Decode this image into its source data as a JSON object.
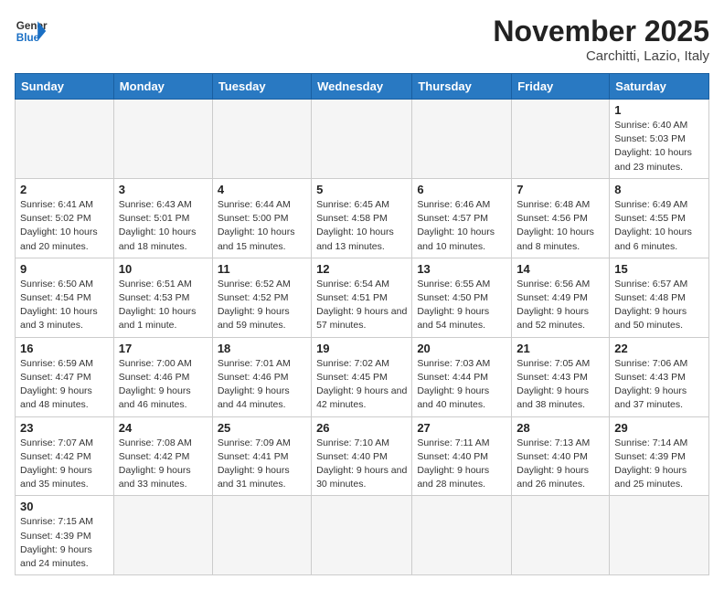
{
  "header": {
    "logo_general": "General",
    "logo_blue": "Blue",
    "month": "November 2025",
    "location": "Carchitti, Lazio, Italy"
  },
  "weekdays": [
    "Sunday",
    "Monday",
    "Tuesday",
    "Wednesday",
    "Thursday",
    "Friday",
    "Saturday"
  ],
  "weeks": [
    [
      {
        "day": "",
        "info": ""
      },
      {
        "day": "",
        "info": ""
      },
      {
        "day": "",
        "info": ""
      },
      {
        "day": "",
        "info": ""
      },
      {
        "day": "",
        "info": ""
      },
      {
        "day": "",
        "info": ""
      },
      {
        "day": "1",
        "info": "Sunrise: 6:40 AM\nSunset: 5:03 PM\nDaylight: 10 hours and 23 minutes."
      }
    ],
    [
      {
        "day": "2",
        "info": "Sunrise: 6:41 AM\nSunset: 5:02 PM\nDaylight: 10 hours and 20 minutes."
      },
      {
        "day": "3",
        "info": "Sunrise: 6:43 AM\nSunset: 5:01 PM\nDaylight: 10 hours and 18 minutes."
      },
      {
        "day": "4",
        "info": "Sunrise: 6:44 AM\nSunset: 5:00 PM\nDaylight: 10 hours and 15 minutes."
      },
      {
        "day": "5",
        "info": "Sunrise: 6:45 AM\nSunset: 4:58 PM\nDaylight: 10 hours and 13 minutes."
      },
      {
        "day": "6",
        "info": "Sunrise: 6:46 AM\nSunset: 4:57 PM\nDaylight: 10 hours and 10 minutes."
      },
      {
        "day": "7",
        "info": "Sunrise: 6:48 AM\nSunset: 4:56 PM\nDaylight: 10 hours and 8 minutes."
      },
      {
        "day": "8",
        "info": "Sunrise: 6:49 AM\nSunset: 4:55 PM\nDaylight: 10 hours and 6 minutes."
      }
    ],
    [
      {
        "day": "9",
        "info": "Sunrise: 6:50 AM\nSunset: 4:54 PM\nDaylight: 10 hours and 3 minutes."
      },
      {
        "day": "10",
        "info": "Sunrise: 6:51 AM\nSunset: 4:53 PM\nDaylight: 10 hours and 1 minute."
      },
      {
        "day": "11",
        "info": "Sunrise: 6:52 AM\nSunset: 4:52 PM\nDaylight: 9 hours and 59 minutes."
      },
      {
        "day": "12",
        "info": "Sunrise: 6:54 AM\nSunset: 4:51 PM\nDaylight: 9 hours and 57 minutes."
      },
      {
        "day": "13",
        "info": "Sunrise: 6:55 AM\nSunset: 4:50 PM\nDaylight: 9 hours and 54 minutes."
      },
      {
        "day": "14",
        "info": "Sunrise: 6:56 AM\nSunset: 4:49 PM\nDaylight: 9 hours and 52 minutes."
      },
      {
        "day": "15",
        "info": "Sunrise: 6:57 AM\nSunset: 4:48 PM\nDaylight: 9 hours and 50 minutes."
      }
    ],
    [
      {
        "day": "16",
        "info": "Sunrise: 6:59 AM\nSunset: 4:47 PM\nDaylight: 9 hours and 48 minutes."
      },
      {
        "day": "17",
        "info": "Sunrise: 7:00 AM\nSunset: 4:46 PM\nDaylight: 9 hours and 46 minutes."
      },
      {
        "day": "18",
        "info": "Sunrise: 7:01 AM\nSunset: 4:46 PM\nDaylight: 9 hours and 44 minutes."
      },
      {
        "day": "19",
        "info": "Sunrise: 7:02 AM\nSunset: 4:45 PM\nDaylight: 9 hours and 42 minutes."
      },
      {
        "day": "20",
        "info": "Sunrise: 7:03 AM\nSunset: 4:44 PM\nDaylight: 9 hours and 40 minutes."
      },
      {
        "day": "21",
        "info": "Sunrise: 7:05 AM\nSunset: 4:43 PM\nDaylight: 9 hours and 38 minutes."
      },
      {
        "day": "22",
        "info": "Sunrise: 7:06 AM\nSunset: 4:43 PM\nDaylight: 9 hours and 37 minutes."
      }
    ],
    [
      {
        "day": "23",
        "info": "Sunrise: 7:07 AM\nSunset: 4:42 PM\nDaylight: 9 hours and 35 minutes."
      },
      {
        "day": "24",
        "info": "Sunrise: 7:08 AM\nSunset: 4:42 PM\nDaylight: 9 hours and 33 minutes."
      },
      {
        "day": "25",
        "info": "Sunrise: 7:09 AM\nSunset: 4:41 PM\nDaylight: 9 hours and 31 minutes."
      },
      {
        "day": "26",
        "info": "Sunrise: 7:10 AM\nSunset: 4:40 PM\nDaylight: 9 hours and 30 minutes."
      },
      {
        "day": "27",
        "info": "Sunrise: 7:11 AM\nSunset: 4:40 PM\nDaylight: 9 hours and 28 minutes."
      },
      {
        "day": "28",
        "info": "Sunrise: 7:13 AM\nSunset: 4:40 PM\nDaylight: 9 hours and 26 minutes."
      },
      {
        "day": "29",
        "info": "Sunrise: 7:14 AM\nSunset: 4:39 PM\nDaylight: 9 hours and 25 minutes."
      }
    ],
    [
      {
        "day": "30",
        "info": "Sunrise: 7:15 AM\nSunset: 4:39 PM\nDaylight: 9 hours and 24 minutes."
      },
      {
        "day": "",
        "info": ""
      },
      {
        "day": "",
        "info": ""
      },
      {
        "day": "",
        "info": ""
      },
      {
        "day": "",
        "info": ""
      },
      {
        "day": "",
        "info": ""
      },
      {
        "day": "",
        "info": ""
      }
    ]
  ]
}
